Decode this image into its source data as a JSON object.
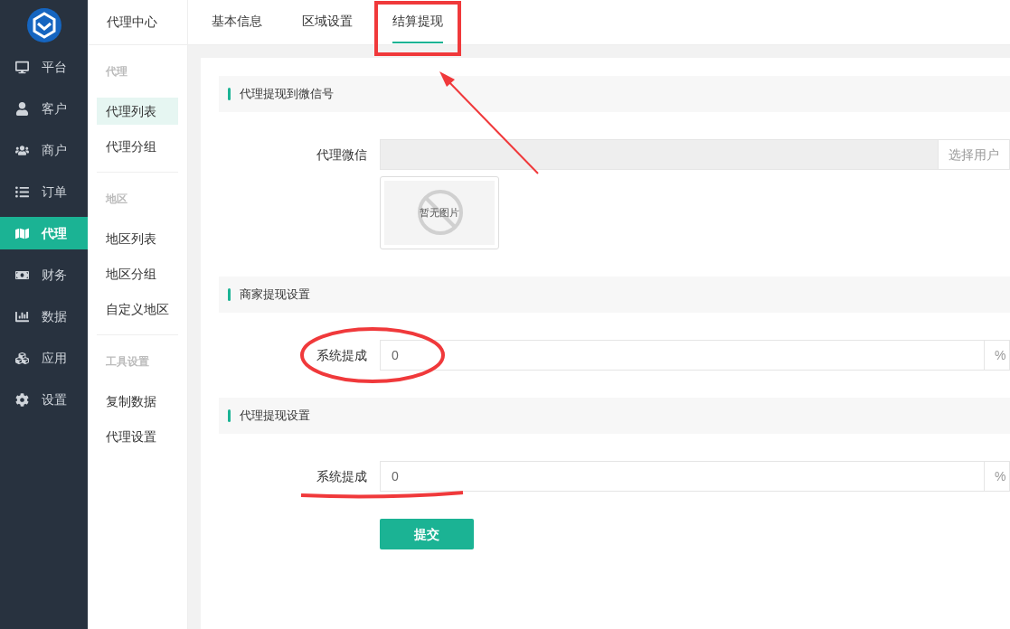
{
  "sidebar": {
    "items": [
      {
        "label": "平台",
        "selected": false
      },
      {
        "label": "客户",
        "selected": false
      },
      {
        "label": "商户",
        "selected": false
      },
      {
        "label": "订单",
        "selected": false
      },
      {
        "label": "代理",
        "selected": true
      },
      {
        "label": "财务",
        "selected": false
      },
      {
        "label": "数据",
        "selected": false
      },
      {
        "label": "应用",
        "selected": false
      },
      {
        "label": "设置",
        "selected": false
      }
    ]
  },
  "subnav": {
    "title": "代理中心",
    "groups": [
      {
        "heading": "代理",
        "items": [
          {
            "label": "代理列表",
            "selected": true
          },
          {
            "label": "代理分组",
            "selected": false
          }
        ]
      },
      {
        "heading": "地区",
        "items": [
          {
            "label": "地区列表",
            "selected": false
          },
          {
            "label": "地区分组",
            "selected": false
          },
          {
            "label": "自定义地区",
            "selected": false
          }
        ]
      },
      {
        "heading": "工具设置",
        "items": [
          {
            "label": "复制数据",
            "selected": false
          },
          {
            "label": "代理设置",
            "selected": false
          }
        ]
      }
    ]
  },
  "tabs": [
    {
      "label": "基本信息",
      "selected": false
    },
    {
      "label": "区域设置",
      "selected": false
    },
    {
      "label": "结算提现",
      "selected": true
    }
  ],
  "sections": [
    {
      "title": "代理提现到微信号",
      "fields": [
        {
          "kind": "picker",
          "label": "代理微信",
          "button": "选择用户",
          "image_placeholder": "暂无图片"
        }
      ]
    },
    {
      "title": "商家提现设置",
      "fields": [
        {
          "kind": "percent",
          "label": "系统提成",
          "value": "0",
          "suffix": "%"
        }
      ]
    },
    {
      "title": "代理提现设置",
      "fields": [
        {
          "kind": "percent",
          "label": "系统提成",
          "value": "0",
          "suffix": "%"
        }
      ]
    }
  ],
  "submit": "提交"
}
